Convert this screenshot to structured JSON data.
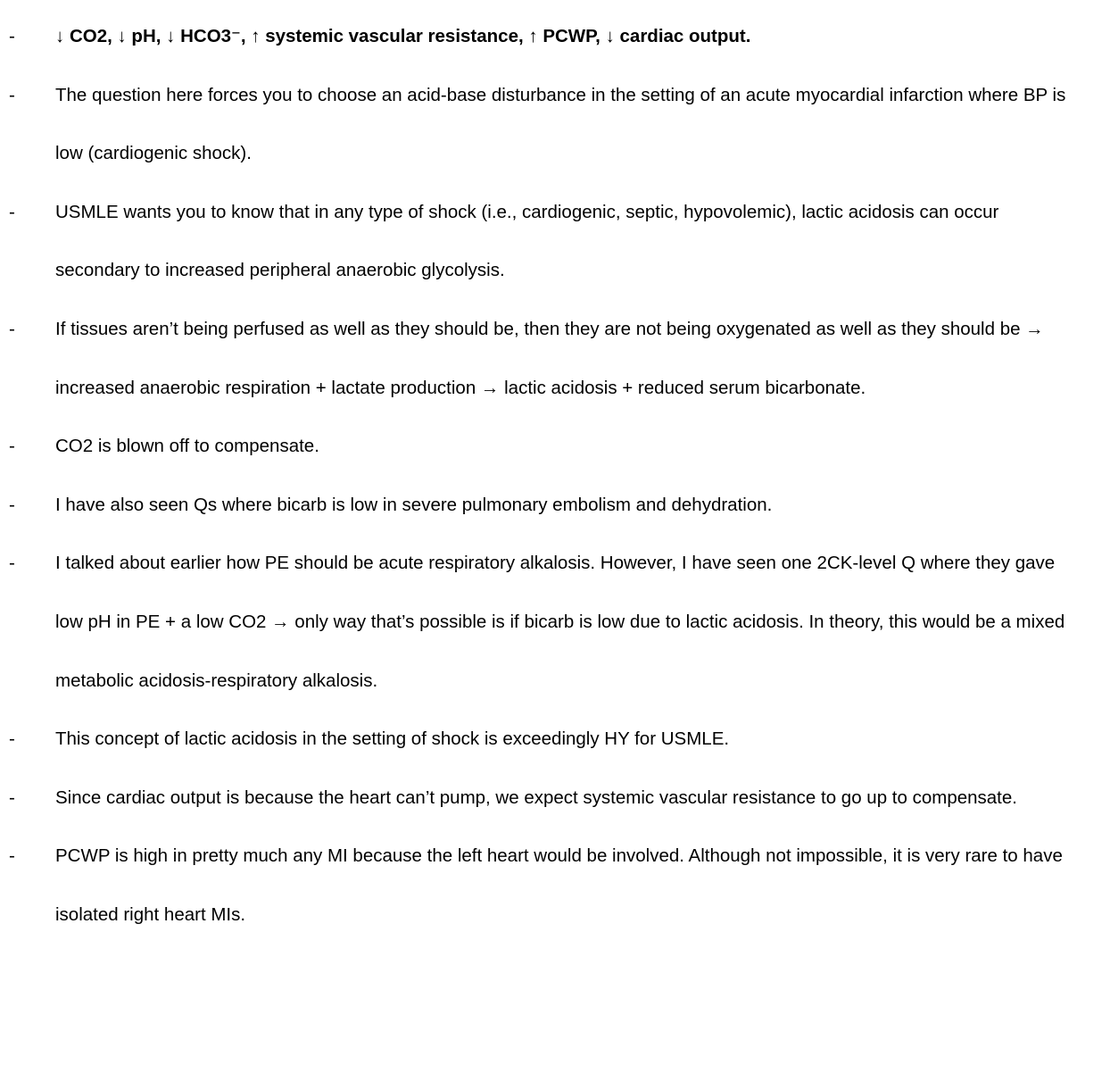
{
  "bullet_marker": "-",
  "items": [
    {
      "text": "↓ CO2, ↓ pH, ↓ HCO3⁻, ↑ systemic vascular resistance, ↑ PCWP, ↓ cardiac output.",
      "bold": true
    },
    {
      "text": "The question here forces you to choose an acid-base disturbance in the setting of an acute myocardial infarction where BP is low (cardiogenic shock)."
    },
    {
      "text": "USMLE wants you to know that in any type of shock (i.e., cardiogenic, septic, hypovolemic), lactic acidosis can occur secondary to increased peripheral anaerobic glycolysis."
    },
    {
      "text": "If tissues aren’t being perfused as well as they should be, then they are not being oxygenated as well as they should be → increased anaerobic respiration + lactate production → lactic acidosis + reduced serum bicarbonate."
    },
    {
      "text": "CO2 is blown off to compensate."
    },
    {
      "text": "I have also seen Qs where bicarb is low in severe pulmonary embolism and dehydration."
    },
    {
      "text": "I talked about earlier how PE should be acute respiratory alkalosis. However, I have seen one 2CK-level Q where they gave low pH in PE + a low CO2 → only way that’s possible is if bicarb is low due to lactic acidosis. In theory, this would be a mixed metabolic acidosis-respiratory alkalosis."
    },
    {
      "text": "This concept of lactic acidosis in the setting of shock is exceedingly HY for USMLE."
    },
    {
      "text": "Since cardiac output is because the heart can’t pump, we expect systemic vascular resistance to go up to compensate."
    },
    {
      "text": "PCWP is high in pretty much any MI because the left heart would be involved. Although not impossible, it is very rare to have isolated right heart MIs."
    }
  ]
}
